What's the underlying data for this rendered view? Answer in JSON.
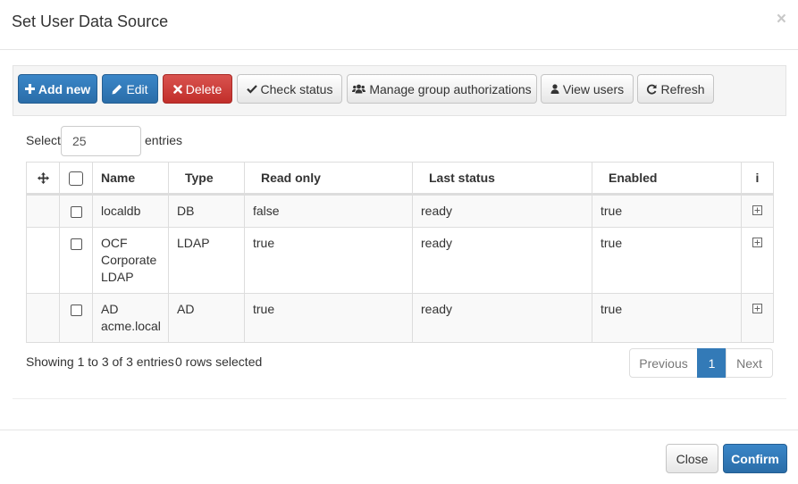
{
  "dialog": {
    "title": "Set User Data Source",
    "close_glyph": "×"
  },
  "toolbar": {
    "buttons": [
      {
        "label": "Add new",
        "icon": "plus-icon",
        "style": "primary"
      },
      {
        "label": "Edit",
        "icon": "pencil-icon",
        "style": "primary"
      },
      {
        "label": "Delete",
        "icon": "times-icon",
        "style": "danger"
      },
      {
        "label": "Check status",
        "icon": "check-icon",
        "style": "default"
      },
      {
        "label": "Manage group authorizations",
        "icon": "users-icon",
        "style": "default"
      },
      {
        "label": "View users",
        "icon": "user-icon",
        "style": "default"
      },
      {
        "label": "Refresh",
        "icon": "refresh-icon",
        "style": "default"
      }
    ]
  },
  "length": {
    "prefix": "Select",
    "value": "25",
    "suffix": "entries"
  },
  "table": {
    "columns": [
      "",
      "",
      "Name",
      "Type",
      "Read only",
      "Last status",
      "Enabled",
      "i"
    ],
    "rows": [
      {
        "name": "localdb",
        "type": "DB",
        "read_only": "false",
        "last_status": "ready",
        "enabled": "true"
      },
      {
        "name": "OCF Corporate LDAP",
        "type": "LDAP",
        "read_only": "true",
        "last_status": "ready",
        "enabled": "true"
      },
      {
        "name": "AD acme.local",
        "type": "AD",
        "read_only": "true",
        "last_status": "ready",
        "enabled": "true"
      }
    ]
  },
  "footer_info": {
    "showing": "Showing 1 to 3 of 3 entries",
    "selected": "0 rows selected"
  },
  "pagination": {
    "previous": "Previous",
    "current": "1",
    "next": "Next"
  },
  "actions": {
    "close": "Close",
    "confirm": "Confirm"
  },
  "colors": {
    "primary": "#337ab7",
    "danger": "#d9534f"
  }
}
